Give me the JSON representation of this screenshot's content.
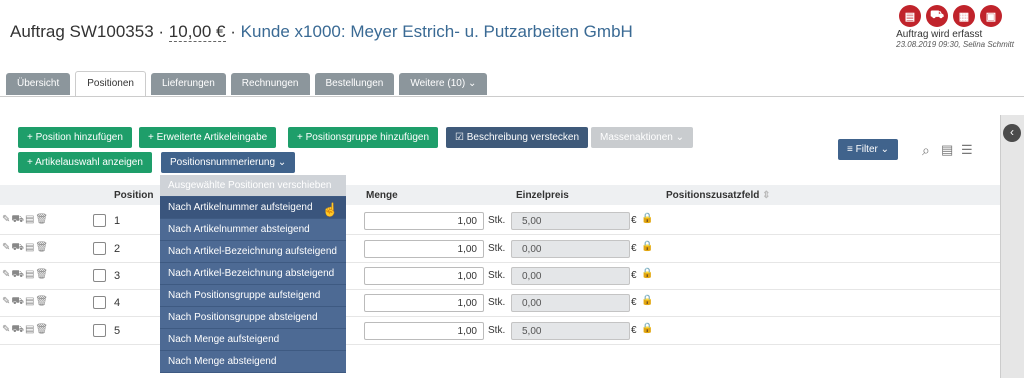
{
  "header": {
    "order_label": "Auftrag SW100353",
    "separator": "·",
    "amount": "10,00 €",
    "customer": "Kunde x1000: Meyer Estrich- u. Putzarbeiten GmbH"
  },
  "status": {
    "label": "Auftrag wird erfasst",
    "meta": "23.08.2019 09:30, Selina Schmitt",
    "icons": [
      "document-icon",
      "truck-icon",
      "invoice-icon",
      "orders-icon"
    ]
  },
  "tabs": [
    "Übersicht",
    "Positionen",
    "Lieferungen",
    "Rechnungen",
    "Bestellungen",
    "Weitere (10) ⌄"
  ],
  "toolbar": {
    "add_position": "Position hinzufügen",
    "extended_entry": "Erweiterte Artikeleingabe",
    "add_group": "Positionsgruppe hinzufügen",
    "hide_description": "Beschreibung verstecken",
    "mass_actions": "Massenaktionen ⌄",
    "show_article_selection": "Artikelauswahl anzeigen",
    "position_numbering": "Positionsnummerierung",
    "filter": "Filter"
  },
  "table": {
    "columns": {
      "position": "Position",
      "menge": "Menge",
      "einzelpreis": "Einzelpreis",
      "zusatzfeld": "Positionszusatzfeld"
    },
    "unit": "Stk.",
    "currency": "€",
    "rows": [
      {
        "pos": "1",
        "qty": "1,00",
        "price": "5,00"
      },
      {
        "pos": "2",
        "qty": "1,00",
        "price": "0,00"
      },
      {
        "pos": "3",
        "qty": "1,00",
        "price": "0,00"
      },
      {
        "pos": "4",
        "qty": "1,00",
        "price": "0,00"
      },
      {
        "pos": "5",
        "qty": "1,00",
        "price": "5,00"
      }
    ]
  },
  "dropdown": {
    "items": [
      "Ausgewählte Positionen verschieben",
      "Nach Artikelnummer aufsteigend",
      "Nach Artikelnummer absteigend",
      "Nach Artikel-Bezeichnung aufsteigend",
      "Nach Artikel-Bezeichnung absteigend",
      "Nach Positionsgruppe aufsteigend",
      "Nach Positionsgruppe absteigend",
      "Nach Menge aufsteigend",
      "Nach Menge absteigend"
    ]
  },
  "colors": {
    "accent_green": "#1e9e6a",
    "accent_blue": "#40638c",
    "status_red": "#c0232b"
  }
}
